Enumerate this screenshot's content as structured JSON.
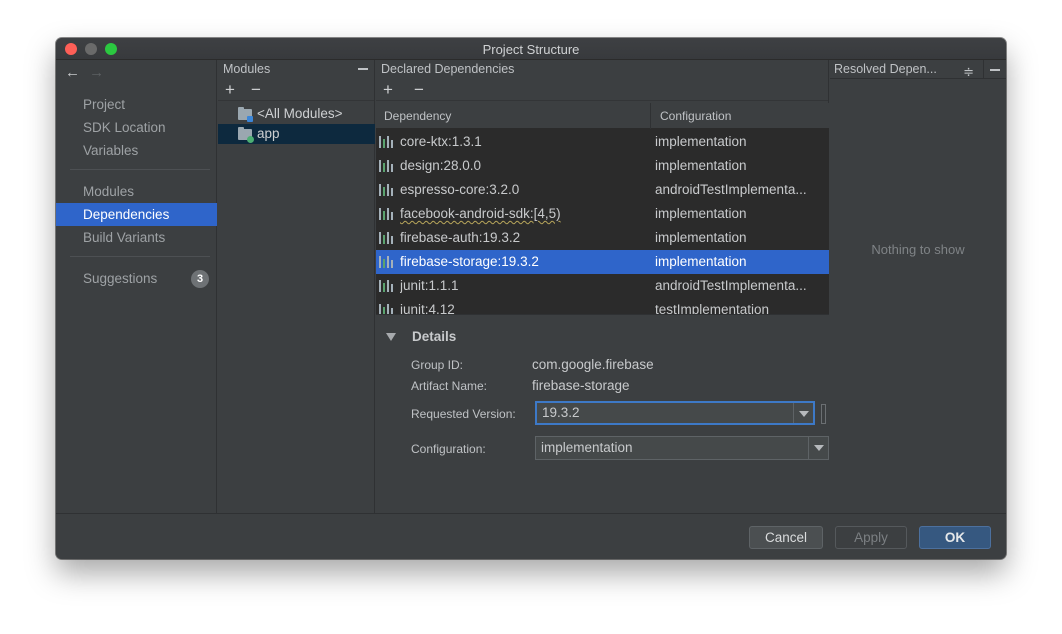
{
  "window": {
    "title": "Project Structure",
    "controls": [
      "close",
      "minimize",
      "maximize"
    ]
  },
  "nav": {
    "back_icon": "←",
    "forward_icon": "→",
    "items": [
      {
        "label": "Project",
        "selected": false
      },
      {
        "label": "SDK Location",
        "selected": false
      },
      {
        "label": "Variables",
        "selected": false
      },
      {
        "label": "Modules",
        "selected": false
      },
      {
        "label": "Dependencies",
        "selected": true
      },
      {
        "label": "Build Variants",
        "selected": false
      },
      {
        "label": "Suggestions",
        "selected": false,
        "badge": "3"
      }
    ]
  },
  "modules": {
    "header": "Modules",
    "add_icon": "+",
    "remove_icon": "−",
    "items": [
      {
        "label": "<All Modules>",
        "selected": false
      },
      {
        "label": "app",
        "selected": true
      }
    ]
  },
  "dependencies": {
    "header": "Declared Dependencies",
    "add_icon": "+",
    "remove_icon": "−",
    "columns": {
      "dependency": "Dependency",
      "configuration": "Configuration"
    },
    "rows": [
      {
        "dependency": "core-ktx:1.3.1",
        "configuration": "implementation",
        "selected": false
      },
      {
        "dependency": "design:28.0.0",
        "configuration": "implementation",
        "selected": false
      },
      {
        "dependency": "espresso-core:3.2.0",
        "configuration": "androidTestImplementa...",
        "selected": false
      },
      {
        "dependency": "facebook-android-sdk:[4,5)",
        "configuration": "implementation",
        "selected": false,
        "warning": true
      },
      {
        "dependency": "firebase-auth:19.3.2",
        "configuration": "implementation",
        "selected": false
      },
      {
        "dependency": "firebase-storage:19.3.2",
        "configuration": "implementation",
        "selected": true
      },
      {
        "dependency": "junit:1.1.1",
        "configuration": "androidTestImplementa...",
        "selected": false
      },
      {
        "dependency": "junit:4.12",
        "configuration": "testImplementation",
        "selected": false
      }
    ]
  },
  "details": {
    "title": "Details",
    "group_id_label": "Group ID:",
    "group_id": "com.google.firebase",
    "artifact_label": "Artifact Name:",
    "artifact": "firebase-storage",
    "version_label": "Requested Version:",
    "version": "19.3.2",
    "configuration_label": "Configuration:",
    "configuration": "implementation"
  },
  "resolved": {
    "header": "Resolved Depen...",
    "empty_text": "Nothing to show"
  },
  "footer": {
    "cancel": "Cancel",
    "apply": "Apply",
    "ok": "OK"
  }
}
